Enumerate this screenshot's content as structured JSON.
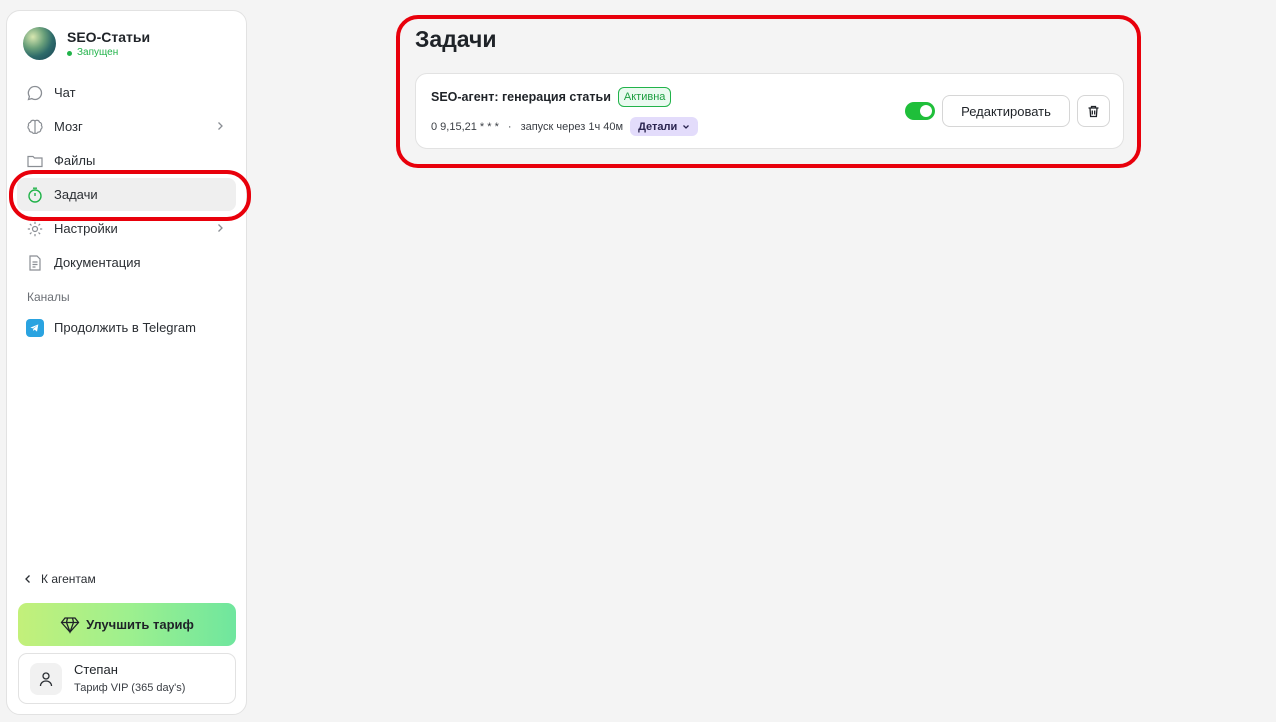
{
  "agent": {
    "name": "SEO-Статьи",
    "status": "Запущен"
  },
  "sidebar": {
    "items": [
      {
        "label": "Чат",
        "icon": "chat-icon"
      },
      {
        "label": "Мозг",
        "icon": "brain-icon"
      },
      {
        "label": "Файлы",
        "icon": "folder-icon"
      },
      {
        "label": "Задачи",
        "icon": "timer-icon"
      },
      {
        "label": "Настройки",
        "icon": "gear-icon"
      },
      {
        "label": "Документация",
        "icon": "document-icon"
      }
    ],
    "channels_label": "Каналы",
    "telegram_label": "Продолжить в Telegram",
    "back_label": "К агентам",
    "upgrade_label": "Улучшить тариф"
  },
  "user": {
    "name": "Степан",
    "plan": "Тариф VIP (365 day's)"
  },
  "main": {
    "title": "Задачи",
    "task": {
      "title": "SEO-агент: генерация статьи",
      "status": "Активна",
      "schedule": "0 9,15,21 * * *",
      "separator": "·",
      "next_run": "запуск через 1ч 40м",
      "details_label": "Детали",
      "enabled": true,
      "edit_label": "Редактировать"
    }
  },
  "colors": {
    "accent_green": "#21b34a",
    "highlight_red": "#e8000b",
    "details_purple": "#e3dcfb",
    "telegram_blue": "#2aa3e0"
  }
}
